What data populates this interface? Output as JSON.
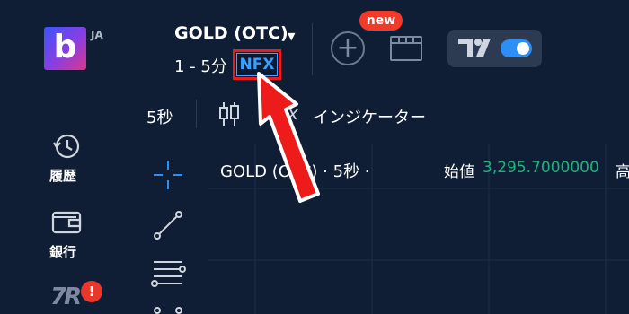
{
  "header": {
    "lang": "JA",
    "logo_letter": "b",
    "asset_title": "GOLD (OTC)",
    "payout": "1 - 5分",
    "badge": "NFX",
    "new_badge": "new",
    "tv_text": "17"
  },
  "toolbar": {
    "interval": "5秒",
    "indicator_label": "インジケーター",
    "fx_glyph": "fx"
  },
  "sidebar": {
    "items": [
      {
        "label": "履歴",
        "icon": "history-icon"
      },
      {
        "label": "銀行",
        "icon": "wallet-icon"
      },
      {
        "label": "7R",
        "icon": "tr-icon",
        "alert": "!"
      }
    ]
  },
  "chart": {
    "symbol_line": "GOLD (OTC) · 5秒 ·",
    "open_label": "始値",
    "open_value": "3,295.7000000",
    "high_label": "高"
  },
  "colors": {
    "background": "#0f1e34",
    "accent_blue": "#2c8ff5",
    "alert_red": "#e8382b",
    "price_green": "#1fb27e"
  }
}
